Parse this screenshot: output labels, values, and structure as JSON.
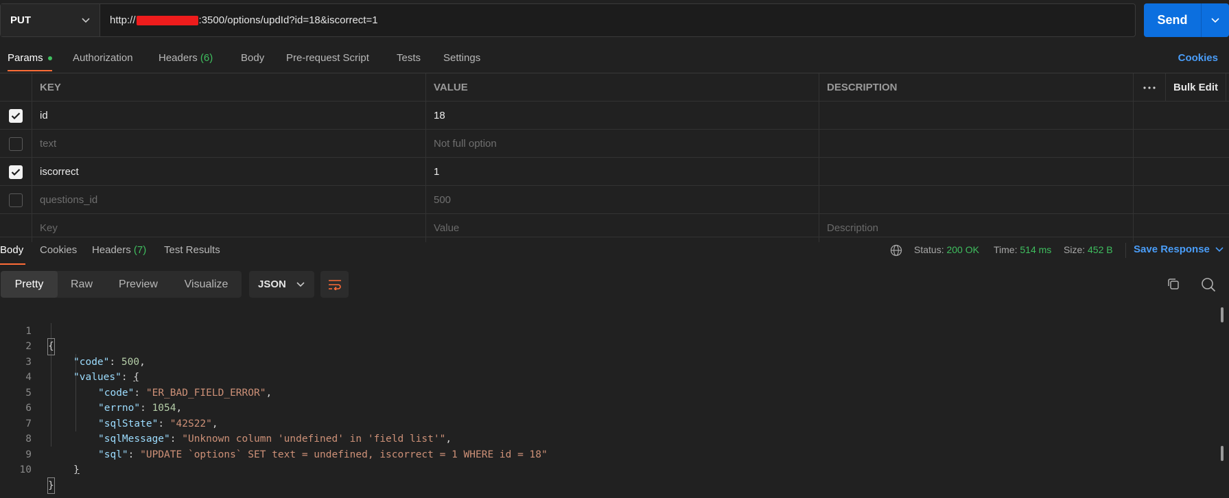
{
  "request": {
    "method": "PUT",
    "url_prefix": "http://",
    "url_suffix": ":3500/options/updId?id=18&iscorrect=1",
    "send_label": "Send"
  },
  "req_tabs": {
    "params": "Params",
    "authorization": "Authorization",
    "headers": "Headers",
    "headers_count": "(6)",
    "body": "Body",
    "prerequest": "Pre-request Script",
    "tests": "Tests",
    "settings": "Settings",
    "cookies": "Cookies"
  },
  "params_table": {
    "headers": {
      "key": "KEY",
      "value": "VALUE",
      "description": "DESCRIPTION",
      "bulk_edit": "Bulk Edit"
    },
    "rows": [
      {
        "checked": true,
        "key": "id",
        "value": "18",
        "description": ""
      },
      {
        "checked": false,
        "key": "text",
        "value": "Not full option",
        "description": ""
      },
      {
        "checked": true,
        "key": "iscorrect",
        "value": "1",
        "description": ""
      },
      {
        "checked": false,
        "key": "questions_id",
        "value": "500",
        "description": ""
      }
    ],
    "placeholders": {
      "key": "Key",
      "value": "Value",
      "description": "Description"
    }
  },
  "response": {
    "tabs": {
      "body": "Body",
      "cookies": "Cookies",
      "headers": "Headers",
      "headers_count": "(7)",
      "test_results": "Test Results"
    },
    "status_label": "Status:",
    "status": "200 OK",
    "time_label": "Time:",
    "time": "514 ms",
    "size_label": "Size:",
    "size": "452 B",
    "save_response": "Save Response",
    "views": {
      "pretty": "Pretty",
      "raw": "Raw",
      "preview": "Preview",
      "visualize": "Visualize"
    },
    "format": "JSON"
  },
  "code_lines": [
    {
      "n": "1"
    },
    {
      "n": "2",
      "key": "\"code\"",
      "num": "500"
    },
    {
      "n": "3",
      "key": "\"values\""
    },
    {
      "n": "4",
      "key": "\"code\"",
      "str": "\"ER_BAD_FIELD_ERROR\""
    },
    {
      "n": "5",
      "key": "\"errno\"",
      "num": "1054"
    },
    {
      "n": "6",
      "key": "\"sqlState\"",
      "str": "\"42S22\""
    },
    {
      "n": "7",
      "key": "\"sqlMessage\"",
      "str": "\"Unknown column 'undefined' in 'field list'\""
    },
    {
      "n": "8",
      "key": "\"sql\"",
      "str": "\"UPDATE `options` SET text = undefined, iscorrect = 1 WHERE id = 18\""
    },
    {
      "n": "9"
    },
    {
      "n": "10"
    }
  ],
  "colors": {
    "accent_orange": "#ff6c37",
    "send_blue": "#0c6fdf",
    "link_blue": "#4a9df8",
    "status_green": "#3fbf5f"
  }
}
